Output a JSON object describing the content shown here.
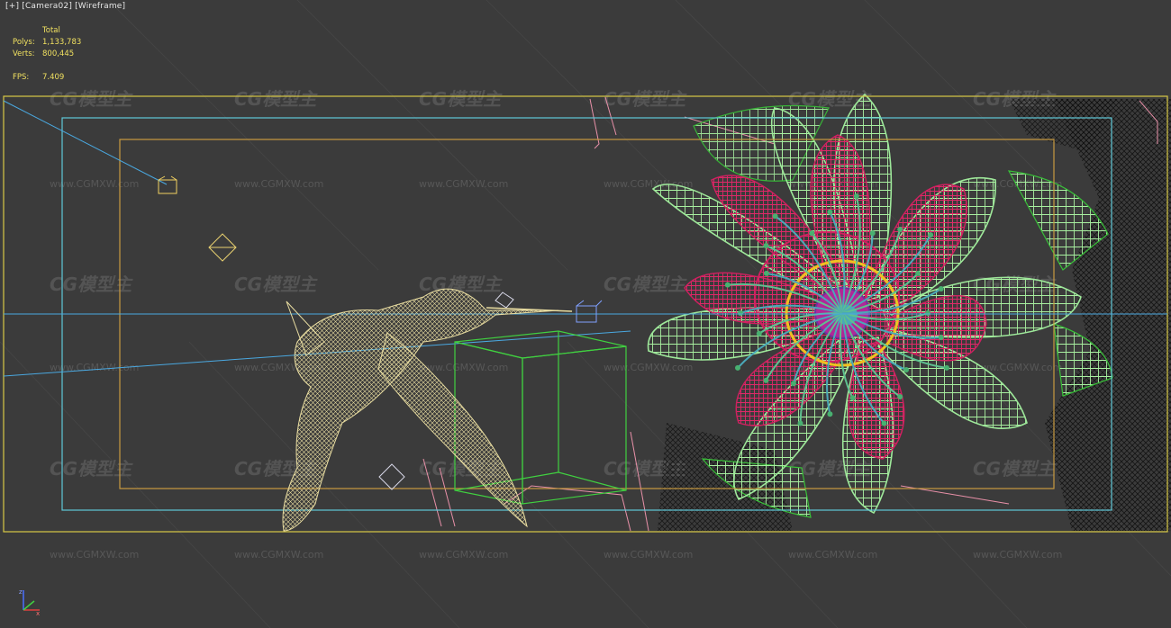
{
  "viewport": {
    "menu_label": "[+]",
    "camera_label": "[Camera02]",
    "shading_label": "[Wireframe]"
  },
  "stats": {
    "total_label": "Total",
    "polys_label": "Polys:",
    "polys_value": "1,133,783",
    "verts_label": "Verts:",
    "verts_value": "800,445",
    "fps_label": "FPS:",
    "fps_value": "7.409"
  },
  "watermark": {
    "logo_text": "CG模型主",
    "url_text": "www.CGMXW.com"
  },
  "colors": {
    "background": "#3b3b3b",
    "safe_frame_outer": "#d8c845",
    "safe_frame_action": "#5fc8d8",
    "safe_frame_title": "#c89a40",
    "hummingbird": "#e8dca0",
    "flower_petals_outer": "#9ee89a",
    "flower_petals_inner": "#d02060",
    "flower_stamens": "#4aa8b8",
    "flower_center": "#f0c020",
    "leaf_green": "#38c038",
    "cube_green": "#40d040",
    "pink_lines": "#e890a8",
    "camera_line": "#4aa8e0",
    "stats_text": "#f0e060"
  }
}
